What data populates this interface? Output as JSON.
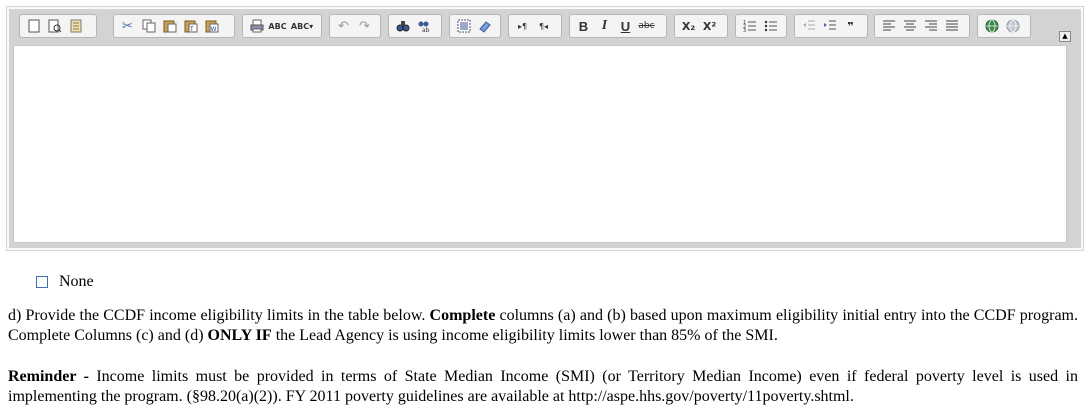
{
  "toolbar": {
    "buttons": [
      {
        "name": "new-page",
        "glyph": ""
      },
      {
        "name": "preview",
        "glyph": ""
      },
      {
        "name": "templates",
        "glyph": ""
      },
      {
        "name": "cut",
        "glyph": "✂"
      },
      {
        "name": "copy",
        "glyph": ""
      },
      {
        "name": "paste",
        "glyph": ""
      },
      {
        "name": "paste-text",
        "glyph": ""
      },
      {
        "name": "paste-word",
        "glyph": ""
      },
      {
        "name": "print",
        "glyph": ""
      },
      {
        "name": "spellcheck",
        "glyph": "ABC"
      },
      {
        "name": "spellcheck-menu",
        "glyph": "ABC▾"
      },
      {
        "name": "undo",
        "glyph": "↶"
      },
      {
        "name": "redo",
        "glyph": "↷"
      },
      {
        "name": "find",
        "glyph": ""
      },
      {
        "name": "replace",
        "glyph": ""
      },
      {
        "name": "select-all",
        "glyph": ""
      },
      {
        "name": "remove-format",
        "glyph": ""
      },
      {
        "name": "ltr",
        "glyph": "▸¶"
      },
      {
        "name": "rtl",
        "glyph": "¶◂"
      },
      {
        "name": "bold",
        "glyph": "B"
      },
      {
        "name": "italic",
        "glyph": "I"
      },
      {
        "name": "underline",
        "glyph": "U"
      },
      {
        "name": "strikethrough",
        "glyph": "abc"
      },
      {
        "name": "subscript",
        "glyph": "X₂"
      },
      {
        "name": "superscript",
        "glyph": "X²"
      },
      {
        "name": "numbered-list",
        "glyph": ""
      },
      {
        "name": "bulleted-list",
        "glyph": ""
      },
      {
        "name": "decrease-indent",
        "glyph": ""
      },
      {
        "name": "increase-indent",
        "glyph": ""
      },
      {
        "name": "blockquote",
        "glyph": "❞"
      },
      {
        "name": "align-left",
        "glyph": ""
      },
      {
        "name": "align-center",
        "glyph": ""
      },
      {
        "name": "align-right",
        "glyph": ""
      },
      {
        "name": "justify",
        "glyph": ""
      },
      {
        "name": "link",
        "glyph": ""
      },
      {
        "name": "unlink",
        "glyph": ""
      }
    ],
    "collapse_glyph": "▲"
  },
  "none_option": {
    "label": "None",
    "checked": false
  },
  "instructions": {
    "p1_a": "d) Provide the CCDF income eligibility limits in the table below. ",
    "p1_b_bold": "Complete",
    "p1_c": " columns (a) and (b) based upon maximum eligibility initial entry into the CCDF program. Complete Columns (c) and (d) ",
    "p1_d_bold": "ONLY IF",
    "p1_e": " the Lead Agency is using income eligibility limits lower than 85% of the SMI.",
    "p2_a_bold": "Reminder -",
    "p2_b": " Income limits must be provided in terms of State Median Income (SMI) (or Territory Median Income) even if federal poverty level is used in implementing the program. (§98.20(a)(2)). FY 2011 poverty guidelines are available at http://aspe.hhs.gov/poverty/11poverty.shtml."
  }
}
